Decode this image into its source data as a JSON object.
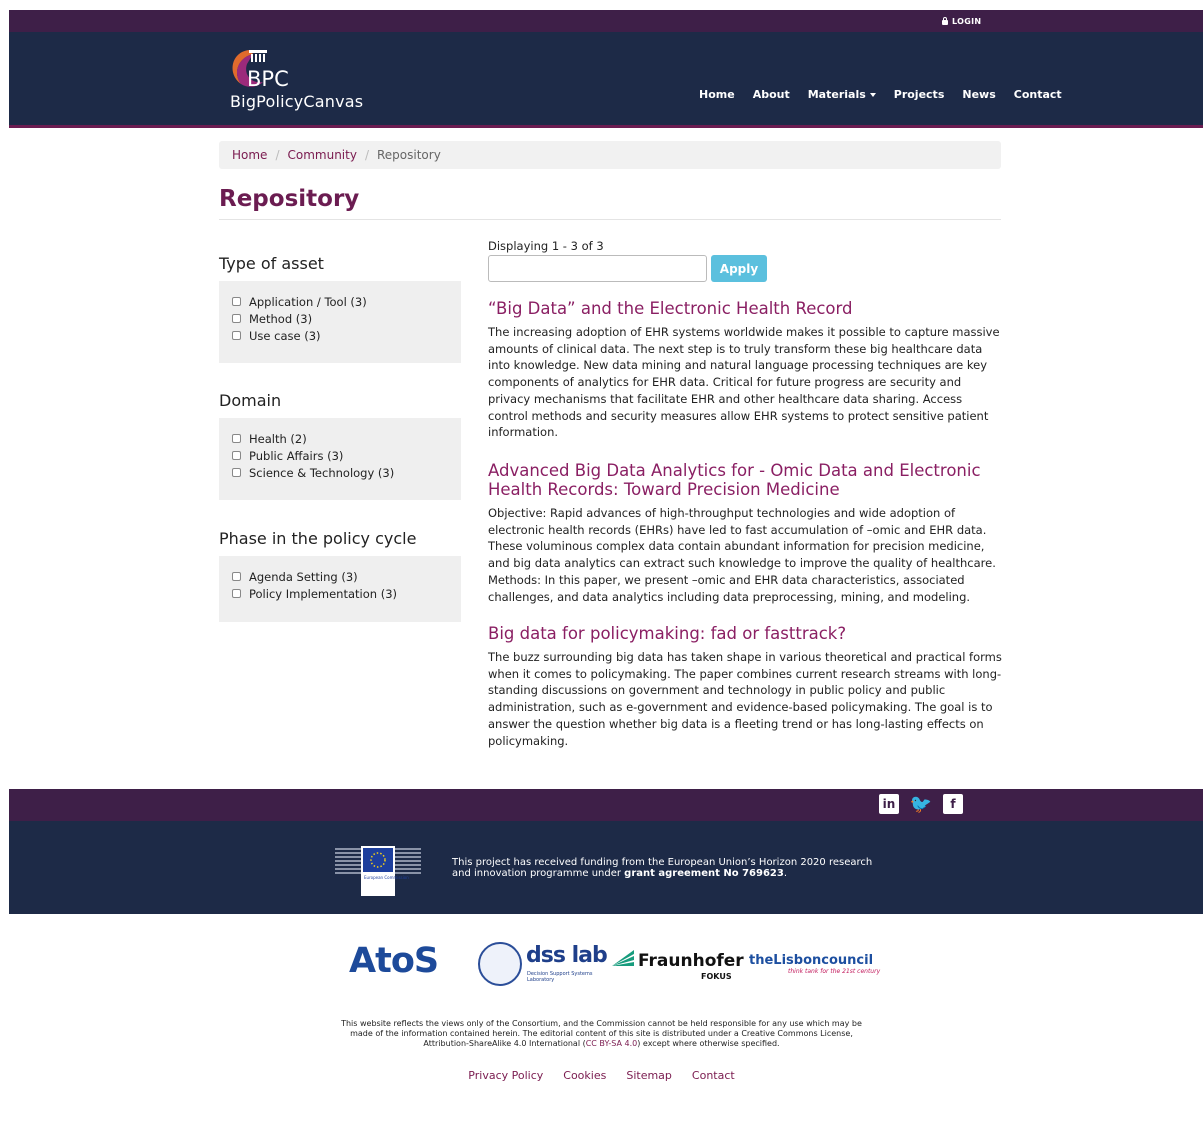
{
  "topbar": {
    "login_label": "LOGIN"
  },
  "brand": {
    "abbr": "BPC",
    "name": "BigPolicyCanvas"
  },
  "nav": {
    "items": [
      "Home",
      "About",
      "Materials",
      "Projects",
      "News",
      "Contact"
    ]
  },
  "breadcrumb": {
    "items": [
      "Home",
      "Community",
      "Repository"
    ]
  },
  "page": {
    "title": "Repository"
  },
  "facets": [
    {
      "title": "Type of asset",
      "options": [
        "Application / Tool (3)",
        "Method (3)",
        "Use case (3)"
      ]
    },
    {
      "title": "Domain",
      "options": [
        "Health (2)",
        "Public Affairs (3)",
        "Science & Technology (3)"
      ]
    },
    {
      "title": "Phase in the policy cycle",
      "options": [
        "Agenda Setting (3)",
        "Policy Implementation (3)"
      ]
    }
  ],
  "results_header": {
    "displaying": "Displaying 1 - 3 of 3",
    "search_value": "",
    "apply_label": "Apply"
  },
  "results": [
    {
      "title": "“Big Data” and the Electronic Health Record",
      "summary": "The increasing adoption of EHR systems worldwide makes it possible to capture massive amounts of clinical data. The next step is to truly transform these big healthcare data into knowledge. New data mining and natural language processing techniques are key components of analytics for EHR data. Critical for future progress are security and privacy mechanisms that facilitate EHR and other healthcare data sharing. Access control methods and security measures allow EHR systems to protect sensitive patient information."
    },
    {
      "title": "Advanced Big Data Analytics for - Omic Data and Electronic Health Records: Toward Precision Medicine",
      "summary": "Objective: Rapid advances of high-throughput technologies and wide adoption of electronic health records (EHRs) have led to fast accumulation of –omic and EHR data. These voluminous complex data contain abundant information for precision medicine, and big data analytics can extract such knowledge to improve the quality of healthcare. Methods: In this paper, we present –omic and EHR data characteristics, associated challenges, and data analytics including data preprocessing, mining, and modeling."
    },
    {
      "title": "Big data for policymaking: fad or fasttrack?",
      "summary": "The buzz surrounding big data has taken shape in various theoretical and practical forms when it comes to policymaking. The paper combines current research streams with long-standing discussions on government and technology in public policy and public administration, such as e-government and evidence-based policymaking. The goal is to answer the question whether big data is a fleeting trend or has long-lasting effects on policymaking."
    }
  ],
  "footer": {
    "social": [
      "linkedin-icon",
      "twitter-icon",
      "facebook-icon"
    ],
    "ec_label": "European Commission",
    "funding_line1": "This project has received funding from the European Union’s Horizon 2020 research",
    "funding_line2_prefix": "and innovation programme under ",
    "funding_line2_bold": "grant agreement No 769623",
    "partners": {
      "atos": "AtoS",
      "dss": "dss lab",
      "dss_sub": "Decision Support Systems Laboratory",
      "fraunhofer": "Fraunhofer",
      "fokus": "FOKUS",
      "lisbon": "theLisboncouncil",
      "lisbon_sub": "think tank for the 21st century"
    },
    "disclaimer_line1": "This website reflects the views only of the Consortium, and the Commission cannot be held responsible for any use which may be",
    "disclaimer_line2": "made of the information contained herein. The editorial content of this site is distributed under a Creative Commons License,",
    "disclaimer_line3_prefix": "Attribution-ShareAlike 4.0 International (",
    "disclaimer_cc": "CC BY-SA 4.0",
    "disclaimer_line3_suffix": ") except where otherwise specified.",
    "links": [
      "Privacy Policy",
      "Cookies",
      "Sitemap",
      "Contact"
    ]
  },
  "colors": {
    "brand_dark": "#1d2a47",
    "brand_purple": "#3e1f48",
    "accent": "#8a1f63",
    "button": "#5bc0de"
  }
}
